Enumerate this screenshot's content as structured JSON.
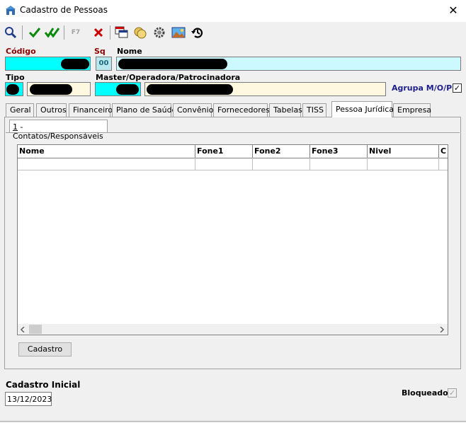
{
  "window": {
    "title": "Cadastro de Pessoas",
    "close_glyph": "✕"
  },
  "toolbar": {
    "f7_label": "F7"
  },
  "fields": {
    "codigo_label": "Código",
    "sq_label": "Sq",
    "sq_value": "00",
    "nome_label": "Nome",
    "tipo_label": "Tipo",
    "master_label": "Master/Operadora/Patrocinadora",
    "agrupa_label": "Agrupa M/O/P",
    "agrupa_checked": "✓"
  },
  "tabs": [
    "Geral",
    "Outros",
    "Financeiro",
    "Plano de Saúde",
    "Convênio",
    "Fornecedores",
    "Tabelas",
    "TISS",
    "Pessoa Jurídica",
    "Empresa"
  ],
  "subtab": {
    "hotkey": "1",
    "label": " - Contatos/Responsáveis"
  },
  "grid": {
    "columns": [
      "Nome",
      "Fone1",
      "Fone2",
      "Fone3",
      "Nivel",
      "C"
    ]
  },
  "buttons": {
    "cadastro": "Cadastro"
  },
  "footer": {
    "cadastro_inicial_label": "Cadastro Inicial",
    "cadastro_inicial_value": "13/12/2023",
    "bloqueado_label": "Bloqueado",
    "bloqueado_checked": "✓"
  },
  "colors": {
    "accent_blue": "#1e1e8c",
    "label_red": "#8b0000",
    "cyan_field": "#00ffff"
  }
}
